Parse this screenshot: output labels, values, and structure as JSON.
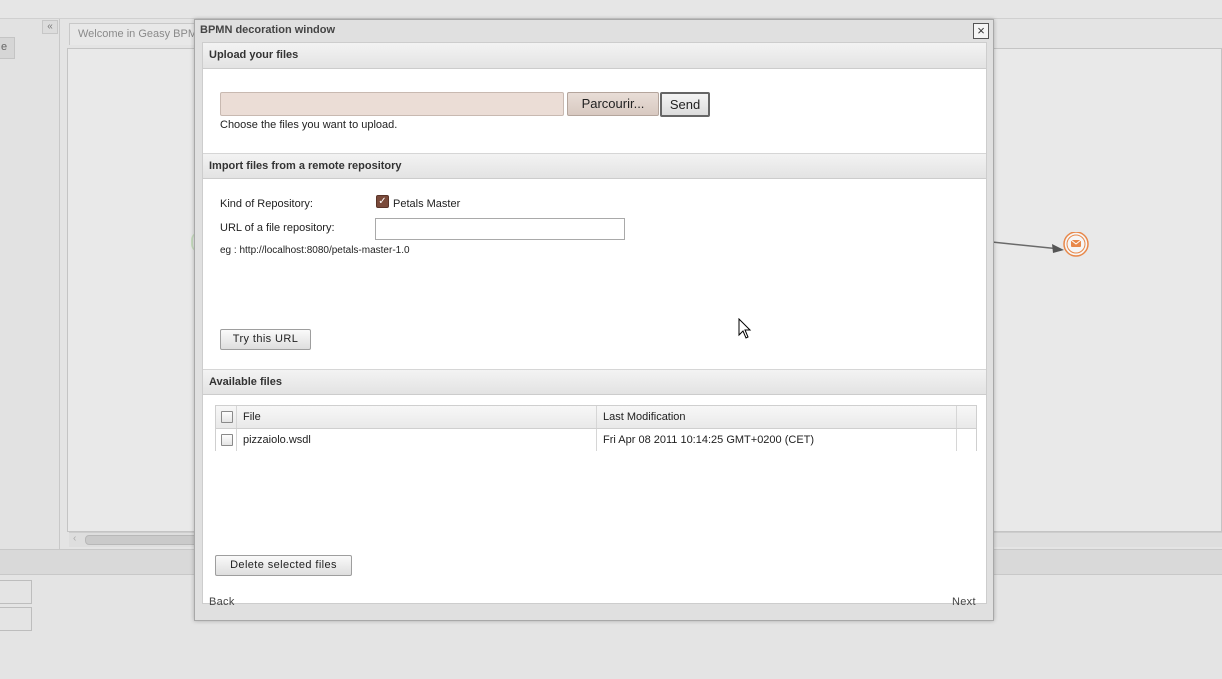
{
  "background": {
    "left_tab_label": "e",
    "collapse_glyph": "«",
    "editor_tab_label": "Welcome in Geasy BPM",
    "scroll_arrow": "‹"
  },
  "modal": {
    "title": "BPMN decoration window",
    "close_glyph": "×",
    "upload_section": {
      "header": "Upload your files",
      "file_value": "",
      "browse_label": "Parcourir...",
      "send_label": "Send",
      "hint": "Choose the files you want to upload."
    },
    "import_section": {
      "header": "Import files from a remote repository",
      "kind_label": "Kind of Repository:",
      "kind_option_label": "Petals Master",
      "kind_option_checked": true,
      "url_label": "URL of a file repository:",
      "url_value": "",
      "example": "eg : http://localhost:8080/petals-master-1.0",
      "try_label": "Try this URL"
    },
    "available_section": {
      "header": "Available files",
      "columns": [
        "File",
        "Last Modification"
      ],
      "rows": [
        {
          "file": "pizzaiolo.wsdl",
          "modified": "Fri Apr 08 2011 10:14:25 GMT+0200 (CET)",
          "checked": false
        }
      ],
      "delete_label": "Delete selected files"
    },
    "footer": {
      "back_label": "Back",
      "next_label": "Next"
    }
  },
  "colors": {
    "checkbox_accent": "#7a4a3a",
    "file_input_bg": "#ebddd6",
    "message_event": "#e8884a"
  }
}
